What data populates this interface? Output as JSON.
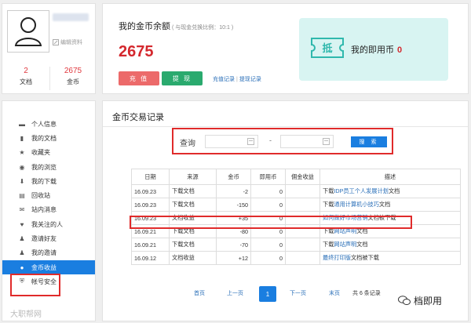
{
  "profile": {
    "edit_label": "编辑资料",
    "docs_count": "2",
    "docs_label": "文档",
    "coins_count": "2675",
    "coins_label": "金币"
  },
  "balance": {
    "title": "我的金币余额",
    "ratio_note": "( 与现金兑换比例：10:1 )",
    "amount": "2675",
    "recharge_label": "充 值",
    "withdraw_label": "提 现",
    "recharge_record": "充值记录",
    "withdraw_record": "提现记录",
    "coupon_glyph": "抵",
    "coupon_label": "我的即用币",
    "coupon_count": "0"
  },
  "sidebar": {
    "items": [
      {
        "label": "个人信息",
        "icon": "id-card-icon"
      },
      {
        "label": "我的文档",
        "icon": "document-icon"
      },
      {
        "label": "收藏夹",
        "icon": "star-icon"
      },
      {
        "label": "我的浏览",
        "icon": "eye-icon"
      },
      {
        "label": "我的下载",
        "icon": "download-icon"
      },
      {
        "label": "回收站",
        "icon": "trash-icon"
      },
      {
        "label": "站内消息",
        "icon": "message-icon"
      },
      {
        "label": "我关注的人",
        "icon": "heart-icon"
      },
      {
        "label": "邀请好友",
        "icon": "invite-icon"
      },
      {
        "label": "我的邀请",
        "icon": "users-icon"
      },
      {
        "label": "金币收益",
        "icon": "coin-bag-icon"
      },
      {
        "label": "帐号安全",
        "icon": "shield-icon"
      }
    ],
    "watermark": "大职帮网"
  },
  "main": {
    "title": "金币交易记录",
    "search_label": "查询",
    "date_sep": "-",
    "search_button": "搜 索",
    "columns": [
      "日期",
      "来源",
      "金币",
      "即用币",
      "佣金收益",
      "描述"
    ],
    "rows": [
      {
        "date": "16.09.23",
        "source": "下载文档",
        "coins": "-2",
        "quick": "0",
        "commission": "",
        "pre": "下载",
        "link": "IDP员工个人发展计划",
        "post": "文档"
      },
      {
        "date": "16.09.23",
        "source": "下载文档",
        "coins": "-150",
        "quick": "0",
        "commission": "",
        "pre": "下载",
        "link": "通用计算机小技巧",
        "post": "文档"
      },
      {
        "date": "16.09.23",
        "source": "文档收益",
        "coins": "+35",
        "quick": "0",
        "commission": "",
        "pre": "",
        "link": "如何做好市场营销",
        "post": "文档被下载"
      },
      {
        "date": "16.09.21",
        "source": "下载文档",
        "coins": "-80",
        "quick": "0",
        "commission": "",
        "pre": "下载",
        "link": "网站声明",
        "post": "文档"
      },
      {
        "date": "16.09.21",
        "source": "下载文档",
        "coins": "-70",
        "quick": "0",
        "commission": "",
        "pre": "下载",
        "link": "网站声明",
        "post": "文档"
      },
      {
        "date": "16.09.12",
        "source": "文档收益",
        "coins": "+12",
        "quick": "0",
        "commission": "",
        "pre": "",
        "link": "最终打印版",
        "post": "文档被下载"
      }
    ],
    "pager": {
      "first": "首页",
      "prev": "上一页",
      "current": "1",
      "next": "下一页",
      "last": "末页",
      "total": "共 6 条记录"
    },
    "watermark": "档即用"
  }
}
